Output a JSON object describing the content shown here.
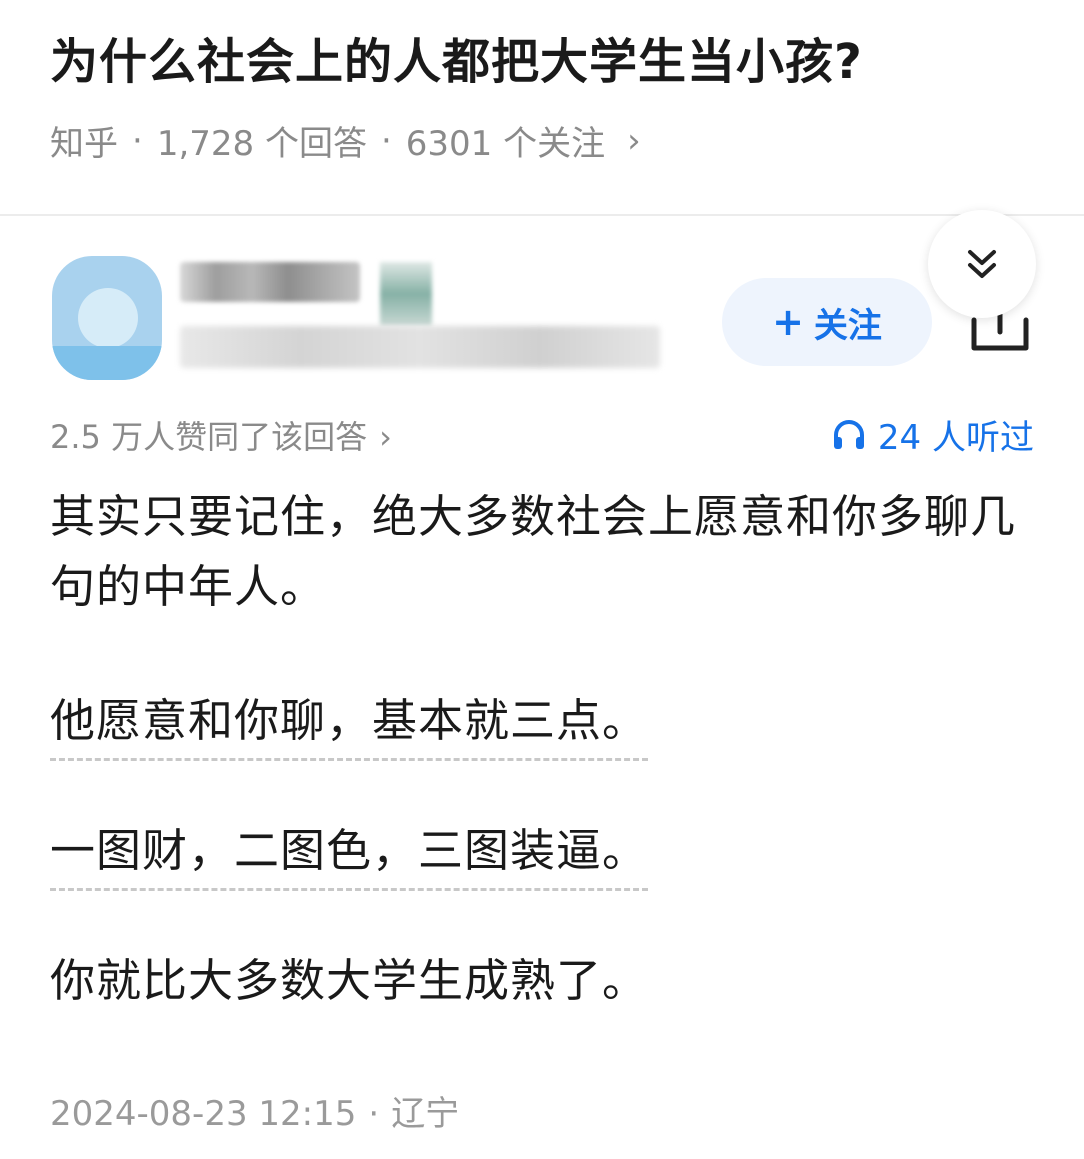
{
  "question": {
    "title": "为什么社会上的人都把大学生当小孩?",
    "source": "知乎",
    "answers": "1,728 个回答",
    "followers": "6301 个关注",
    "sep": "·",
    "chevron": "›"
  },
  "author": {
    "follow_label": "关注",
    "plus": "+"
  },
  "answer": {
    "votes": "2.5 万人赞同了该回答",
    "votes_chevron": "›",
    "listened": "24 人听过",
    "paragraphs": [
      "其实只要记住，绝大多数社会上愿意和你多聊几句的中年人。",
      "他愿意和你聊，基本就三点。",
      "一图财，二图色，三图装逼。",
      "你就比大多数大学生成熟了。"
    ],
    "date": "2024-08-23 12:15",
    "location": "辽宁",
    "meta_sep": "·"
  },
  "colors": {
    "accent": "#1672e8",
    "muted": "#8a8a8a",
    "text": "#1a1a1a"
  },
  "icons": {
    "collapse": "double-chevron-down-icon",
    "share": "share-icon",
    "listen": "headphones-icon"
  }
}
